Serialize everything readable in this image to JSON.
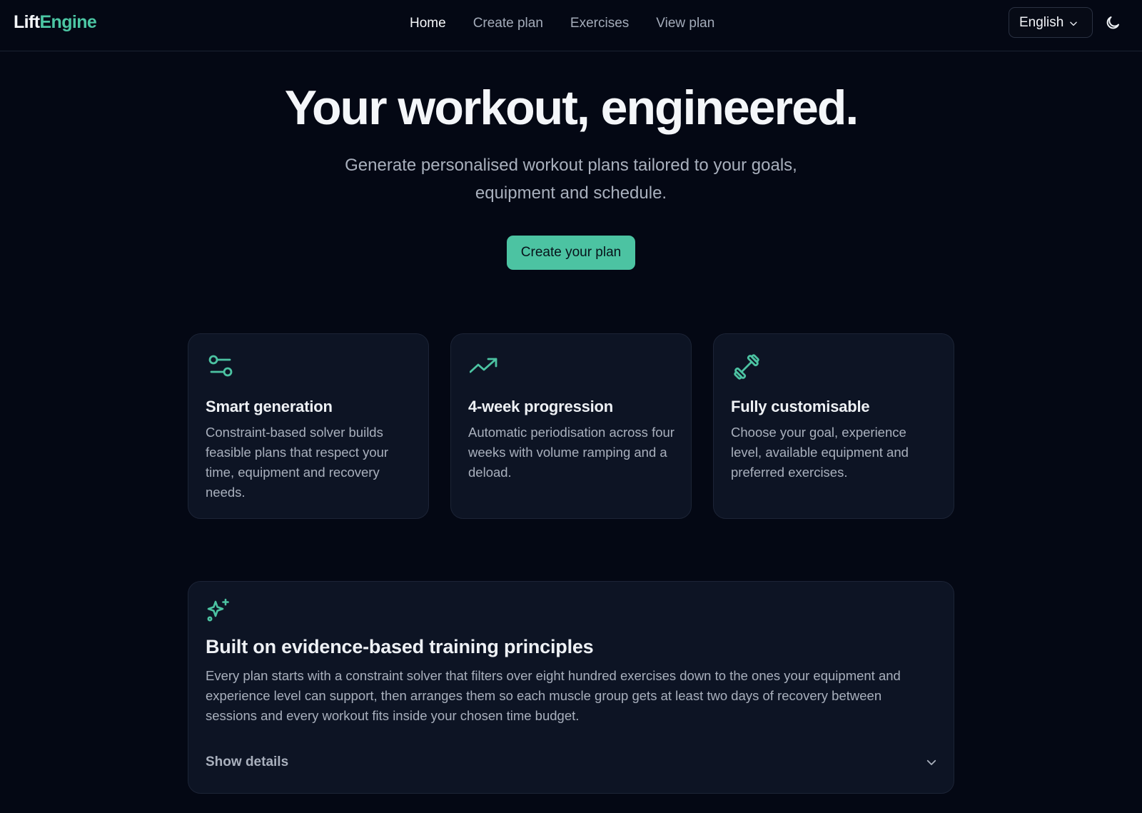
{
  "header": {
    "logo_part1": "Lift",
    "logo_part2": "Engine",
    "nav": [
      {
        "label": "Home",
        "active": true
      },
      {
        "label": "Create plan",
        "active": false
      },
      {
        "label": "Exercises",
        "active": false
      },
      {
        "label": "View plan",
        "active": false
      }
    ],
    "language": "English",
    "theme_icon": "moon-icon"
  },
  "hero": {
    "title": "Your workout, engineered.",
    "subtitle": "Generate personalised workout plans tailored to your goals, equipment and schedule.",
    "cta_label": "Create your plan"
  },
  "features": [
    {
      "icon": "sliders-icon",
      "title": "Smart generation",
      "description": "Constraint-based solver builds feasible plans that respect your time, equipment and recovery needs."
    },
    {
      "icon": "trending-up-icon",
      "title": "4-week progression",
      "description": "Automatic periodisation across four weeks with volume ramping and a deload."
    },
    {
      "icon": "dumbbell-icon",
      "title": "Fully customisable",
      "description": "Choose your goal, experience level, available equipment and preferred exercises."
    }
  ],
  "principles": {
    "icon": "sparkles-icon",
    "title": "Built on evidence-based training principles",
    "body": "Every plan starts with a constraint solver that filters over eight hundred exercises down to the ones your equipment and experience level can support, then arranges them so each muscle group gets at least two days of recovery between sessions and every workout fits inside your chosen time budget.",
    "toggle_label": "Show details"
  },
  "colors": {
    "background": "#040814",
    "accent": "#4cc7a4",
    "card": "#0d1424"
  }
}
